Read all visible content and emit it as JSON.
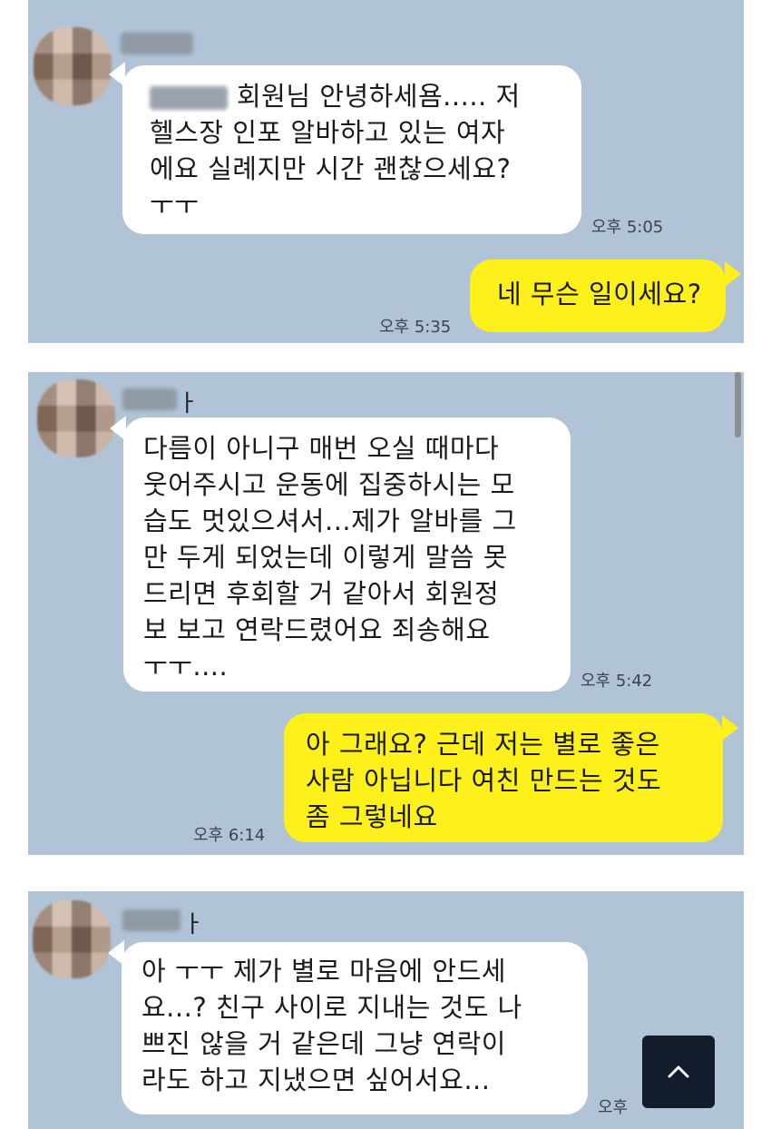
{
  "screenshots": [
    {
      "messages": [
        {
          "sender": "them",
          "name_suffix": "",
          "lines": [
            "회원님 안녕하세욤..... 저",
            "헬스장 인포 알바하고 있는 여자",
            "에요 실례지만 시간 괜찮으세요?",
            "ㅜㅜ"
          ],
          "time": "오후 5:05"
        },
        {
          "sender": "me",
          "lines": [
            "네 무슨 일이세요?"
          ],
          "time": "오후 5:35"
        }
      ]
    },
    {
      "messages": [
        {
          "sender": "them",
          "name_suffix": "ㅏ",
          "lines": [
            "다름이 아니구 매번 오실 때마다",
            "웃어주시고 운동에 집중하시는 모",
            "습도 멋있으셔서...제가 알바를 그",
            "만 두게 되었는데 이렇게 말씀 못",
            "드리면 후회할 거 같아서 회원정",
            "보 보고 연락드렸어요 죄송해요",
            "ㅜㅜ...."
          ],
          "time": "오후 5:42"
        },
        {
          "sender": "me",
          "lines": [
            "아 그래요? 근데 저는 별로 좋은",
            "사람 아닙니다 여친 만드는 것도",
            "좀 그렇네요"
          ],
          "time": "오후 6:14"
        }
      ]
    },
    {
      "messages": [
        {
          "sender": "them",
          "name_suffix": "ㅏ",
          "lines": [
            "아 ㅜㅜ 제가 별로 마음에 안드세",
            "요...? 친구 사이로 지내는 것도 나",
            "쁘진 않을 거 같은데 그냥 연락이",
            "라도 하고 지냈으면 싶어서요..."
          ],
          "time": "오후"
        }
      ]
    }
  ],
  "scroll_top_button": {
    "icon": "chevron-up-icon"
  }
}
